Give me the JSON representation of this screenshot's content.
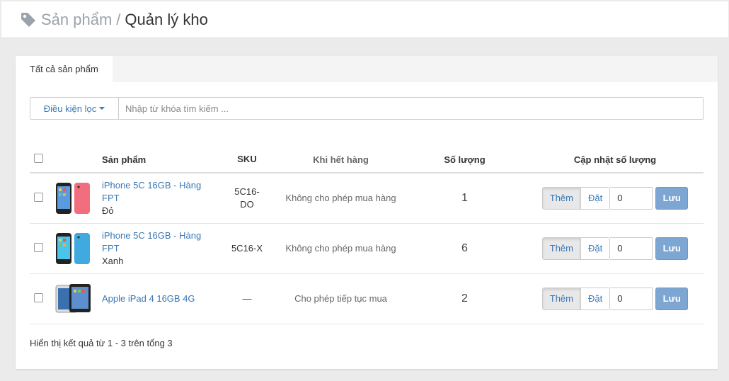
{
  "breadcrumb": {
    "parent": "Sản phẩm",
    "separator": "/",
    "current": "Quản lý kho"
  },
  "tabs": [
    {
      "label": "Tất cả sản phẩm"
    }
  ],
  "filter": {
    "label": "Điều kiện lọc",
    "placeholder": "Nhập từ khóa tìm kiếm ..."
  },
  "table": {
    "headers": {
      "product": "Sản phẩm",
      "sku": "SKU",
      "out_of_stock": "Khi hết hàng",
      "quantity": "Số lượng",
      "update": "Cập nhật số lượng"
    },
    "rows": [
      {
        "name_line1": "iPhone 5C 16GB - Hàng",
        "name_line2": "FPT",
        "variant": "Đỏ",
        "sku_line1": "5C16-",
        "sku_line2": "DO",
        "out_of_stock": "Không cho phép mua hàng",
        "quantity": "1",
        "add_label": "Thêm",
        "set_label": "Đặt",
        "input_value": "0",
        "save_label": "Lưu"
      },
      {
        "name_line1": "iPhone 5C 16GB - Hàng",
        "name_line2": "FPT",
        "variant": "Xanh",
        "sku_line1": "5C16-X",
        "sku_line2": "",
        "out_of_stock": "Không cho phép mua hàng",
        "quantity": "6",
        "add_label": "Thêm",
        "set_label": "Đặt",
        "input_value": "0",
        "save_label": "Lưu"
      },
      {
        "name_line1": "Apple iPad 4 16GB 4G",
        "name_line2": "",
        "variant": "",
        "sku_line1": "—",
        "sku_line2": "",
        "out_of_stock": "Cho phép tiếp tục mua",
        "quantity": "2",
        "add_label": "Thêm",
        "set_label": "Đặt",
        "input_value": "0",
        "save_label": "Lưu"
      }
    ]
  },
  "summary": "Hiển thị kết quả từ 1 - 3 trên tổng 3",
  "colors": {
    "link": "#3a78b3",
    "save_button": "#7da6d3",
    "background": "#ebebeb"
  },
  "icons": {
    "breadcrumb": "tag-icon",
    "filter": "caret-down-icon"
  }
}
